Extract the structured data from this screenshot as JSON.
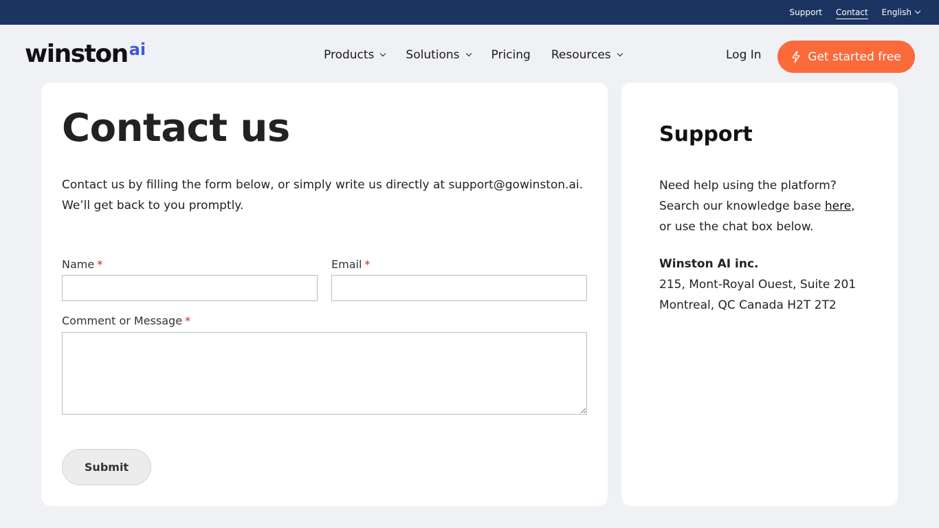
{
  "topbar": {
    "support": "Support",
    "contact": "Contact",
    "language": "English"
  },
  "brand": {
    "name": "winston",
    "suffix": "ai",
    "accent_color": "#3a5bd9"
  },
  "nav": {
    "products": "Products",
    "solutions": "Solutions",
    "pricing": "Pricing",
    "resources": "Resources",
    "login": "Log In",
    "cta": "Get started free",
    "cta_color": "#fb6a3a"
  },
  "contact": {
    "title": "Contact us",
    "intro": "Contact us by filling the form below, or simply write us directly at support@gowinston.ai. We’ll get back to you promptly.",
    "name_label": "Name",
    "email_label": "Email",
    "message_label": "Comment or Message",
    "required_marker": "*",
    "name_value": "",
    "email_value": "",
    "message_value": "",
    "submit_label": "Submit"
  },
  "support": {
    "title": "Support",
    "help_before": "Need help using the platform? Search our knowledge base ",
    "help_link": "here",
    "help_after": ", or use the chat box below.",
    "company": "Winston AI inc.",
    "address_line1": "215, Mont-Royal Ouest, Suite 201",
    "address_line2": "Montreal, QC Canada H2T 2T2"
  }
}
